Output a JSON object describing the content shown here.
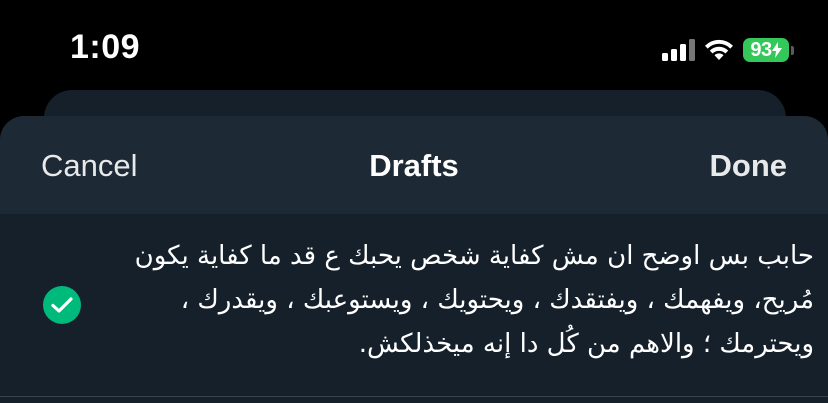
{
  "status_bar": {
    "time": "1:09",
    "battery_level": "93",
    "battery_color": "#34c759",
    "icons": [
      "cellular-signal-icon",
      "wifi-icon",
      "battery-charging-icon"
    ]
  },
  "sheet": {
    "cancel_label": "Cancel",
    "title": "Drafts",
    "done_label": "Done"
  },
  "drafts": [
    {
      "selected": true,
      "text": "حابب بس اوضح ان مش كفاية شخص يحبك ع قد ما كفاية يكون مُريح، ويفهمك ، ويفتقدك ، ويحتويك ، ويستوعبك ، ويقدرك ، ويحترمك ؛ والاهم من كُل دا إنه ميخذلكش."
    }
  ],
  "colors": {
    "background": "#000000",
    "sheet_background": "#15202b",
    "header_background": "#1d2935",
    "check_green": "#00ba7c",
    "text_primary": "#ffffff"
  }
}
